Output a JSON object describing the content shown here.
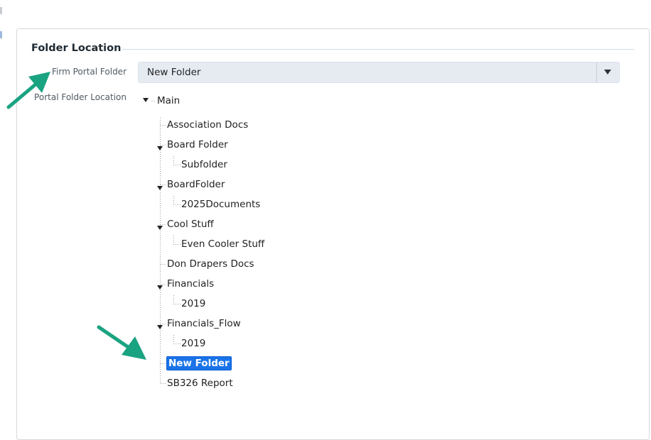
{
  "section": {
    "title": "Folder Location"
  },
  "fields": {
    "firm_portal_folder_label": "Firm Portal Folder",
    "portal_folder_location_label": "Portal Folder Location"
  },
  "select": {
    "value": "New Folder"
  },
  "tree": {
    "root": "Main",
    "nodes": [
      {
        "label": "Association Docs",
        "expanded": false
      },
      {
        "label": "Board Folder",
        "expanded": true
      },
      {
        "label": "Subfolder",
        "expanded": false
      },
      {
        "label": "BoardFolder",
        "expanded": true
      },
      {
        "label": "2025Documents",
        "expanded": false
      },
      {
        "label": "Cool Stuff",
        "expanded": true
      },
      {
        "label": "Even Cooler Stuff",
        "expanded": false
      },
      {
        "label": "Don Drapers Docs",
        "expanded": false
      },
      {
        "label": "Financials",
        "expanded": true
      },
      {
        "label": "2019",
        "expanded": false
      },
      {
        "label": "Financials_Flow",
        "expanded": true
      },
      {
        "label": "2019",
        "expanded": false
      },
      {
        "label": "New Folder",
        "expanded": false,
        "selected": true
      },
      {
        "label": "SB326 Report",
        "expanded": false
      }
    ]
  },
  "colors": {
    "selection": "#1a73e8",
    "annotation_arrow": "#1aa381",
    "select_bg": "#e6ebf2"
  }
}
